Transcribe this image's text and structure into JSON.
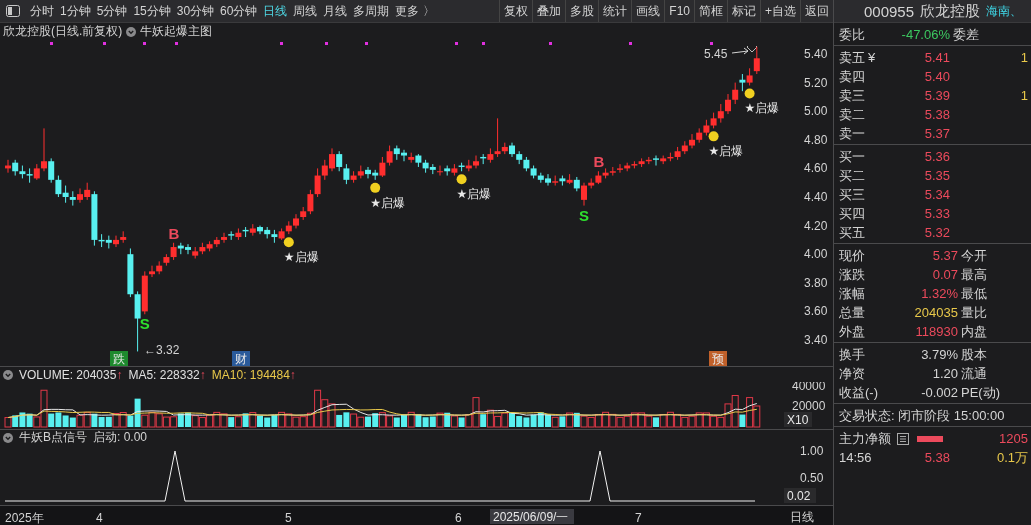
{
  "toolbar": {
    "periods": [
      {
        "label": "分时",
        "selected": false
      },
      {
        "label": "1分钟",
        "selected": false
      },
      {
        "label": "5分钟",
        "selected": false
      },
      {
        "label": "15分钟",
        "selected": false
      },
      {
        "label": "30分钟",
        "selected": false
      },
      {
        "label": "60分钟",
        "selected": false
      },
      {
        "label": "日线",
        "selected": true
      },
      {
        "label": "周线",
        "selected": false
      },
      {
        "label": "月线",
        "selected": false
      },
      {
        "label": "多周期",
        "selected": false
      },
      {
        "label": "更多 〉",
        "selected": false
      }
    ],
    "buttons": [
      "复权",
      "叠加",
      "多股",
      "统计",
      "画线",
      "F10",
      "简框",
      "标记",
      "+自选",
      "返回"
    ]
  },
  "chart_title": {
    "name": "欣龙控股(日线.前复权)",
    "indicator": "牛妖起爆主图"
  },
  "main_chart": {
    "chart_data": {
      "type": "candlestick",
      "ohlc": [
        [
          4.6,
          4.66,
          4.57,
          4.62
        ],
        [
          4.64,
          4.66,
          4.55,
          4.58
        ],
        [
          4.58,
          4.62,
          4.53,
          4.56
        ],
        [
          4.56,
          4.6,
          4.5,
          4.55
        ],
        [
          4.53,
          4.63,
          4.52,
          4.6
        ],
        [
          4.6,
          4.88,
          4.58,
          4.65
        ],
        [
          4.65,
          4.67,
          4.5,
          4.52
        ],
        [
          4.52,
          4.55,
          4.4,
          4.42
        ],
        [
          4.43,
          4.48,
          4.36,
          4.4
        ],
        [
          4.4,
          4.44,
          4.34,
          4.38
        ],
        [
          4.38,
          4.46,
          4.36,
          4.42
        ],
        [
          4.4,
          4.5,
          4.38,
          4.45
        ],
        [
          4.42,
          4.44,
          4.06,
          4.1
        ],
        [
          4.1,
          4.14,
          4.05,
          4.09
        ],
        [
          4.1,
          4.13,
          4.04,
          4.08
        ],
        [
          4.07,
          4.13,
          4.05,
          4.1
        ],
        [
          4.1,
          4.16,
          4.08,
          4.12
        ],
        [
          4.0,
          4.04,
          3.7,
          3.72
        ],
        [
          3.72,
          3.74,
          3.32,
          3.55
        ],
        [
          3.6,
          3.88,
          3.58,
          3.85
        ],
        [
          3.86,
          3.92,
          3.84,
          3.88
        ],
        [
          3.88,
          3.95,
          3.86,
          3.92
        ],
        [
          3.94,
          4.0,
          3.92,
          3.98
        ],
        [
          3.98,
          4.08,
          3.96,
          4.05
        ],
        [
          4.06,
          4.08,
          4.0,
          4.04
        ],
        [
          4.05,
          4.07,
          4.0,
          4.03
        ],
        [
          3.99,
          4.05,
          3.97,
          4.02
        ],
        [
          4.02,
          4.08,
          4.0,
          4.05
        ],
        [
          4.04,
          4.09,
          4.02,
          4.07
        ],
        [
          4.07,
          4.12,
          4.05,
          4.1
        ],
        [
          4.1,
          4.15,
          4.08,
          4.12
        ],
        [
          4.14,
          4.16,
          4.1,
          4.13
        ],
        [
          4.12,
          4.18,
          4.1,
          4.15
        ],
        [
          4.17,
          4.19,
          4.12,
          4.16
        ],
        [
          4.15,
          4.21,
          4.13,
          4.18
        ],
        [
          4.19,
          4.2,
          4.14,
          4.16
        ],
        [
          4.17,
          4.19,
          4.11,
          4.14
        ],
        [
          4.14,
          4.17,
          4.08,
          4.12
        ],
        [
          4.11,
          4.18,
          4.1,
          4.16
        ],
        [
          4.16,
          4.23,
          4.14,
          4.2
        ],
        [
          4.2,
          4.28,
          4.18,
          4.25
        ],
        [
          4.26,
          4.33,
          4.24,
          4.3
        ],
        [
          4.3,
          4.45,
          4.28,
          4.42
        ],
        [
          4.42,
          4.6,
          4.4,
          4.55
        ],
        [
          4.55,
          4.66,
          4.52,
          4.62
        ],
        [
          4.6,
          4.74,
          4.58,
          4.7
        ],
        [
          4.7,
          4.72,
          4.58,
          4.61
        ],
        [
          4.6,
          4.63,
          4.49,
          4.52
        ],
        [
          4.52,
          4.58,
          4.5,
          4.55
        ],
        [
          4.55,
          4.62,
          4.53,
          4.58
        ],
        [
          4.59,
          4.61,
          4.53,
          4.56
        ],
        [
          4.57,
          4.59,
          4.52,
          4.55
        ],
        [
          4.55,
          4.68,
          4.54,
          4.64
        ],
        [
          4.64,
          4.76,
          4.62,
          4.72
        ],
        [
          4.74,
          4.76,
          4.66,
          4.7
        ],
        [
          4.71,
          4.73,
          4.65,
          4.69
        ],
        [
          4.66,
          4.71,
          4.64,
          4.68
        ],
        [
          4.69,
          4.7,
          4.61,
          4.64
        ],
        [
          4.64,
          4.66,
          4.57,
          4.6
        ],
        [
          4.61,
          4.63,
          4.56,
          4.59
        ],
        [
          4.58,
          4.62,
          4.55,
          4.58
        ],
        [
          4.6,
          4.62,
          4.55,
          4.58
        ],
        [
          4.57,
          4.63,
          4.55,
          4.6
        ],
        [
          4.62,
          4.64,
          4.58,
          4.61
        ],
        [
          4.6,
          4.66,
          4.58,
          4.62
        ],
        [
          4.62,
          4.69,
          4.6,
          4.65
        ],
        [
          4.68,
          4.7,
          4.63,
          4.67
        ],
        [
          4.66,
          4.74,
          4.64,
          4.7
        ],
        [
          4.7,
          4.95,
          4.68,
          4.72
        ],
        [
          4.72,
          4.78,
          4.7,
          4.75
        ],
        [
          4.76,
          4.78,
          4.68,
          4.7
        ],
        [
          4.7,
          4.72,
          4.63,
          4.66
        ],
        [
          4.66,
          4.68,
          4.58,
          4.6
        ],
        [
          4.6,
          4.62,
          4.53,
          4.55
        ],
        [
          4.55,
          4.57,
          4.5,
          4.52
        ],
        [
          4.53,
          4.56,
          4.48,
          4.5
        ],
        [
          4.5,
          4.55,
          4.48,
          4.51
        ],
        [
          4.53,
          4.55,
          4.48,
          4.51
        ],
        [
          4.5,
          4.56,
          4.49,
          4.52
        ],
        [
          4.52,
          4.54,
          4.44,
          4.46
        ],
        [
          4.38,
          4.5,
          4.34,
          4.48
        ],
        [
          4.48,
          4.53,
          4.46,
          4.5
        ],
        [
          4.5,
          4.58,
          4.49,
          4.55
        ],
        [
          4.55,
          4.6,
          4.53,
          4.57
        ],
        [
          4.57,
          4.61,
          4.55,
          4.58
        ],
        [
          4.59,
          4.63,
          4.57,
          4.6
        ],
        [
          4.6,
          4.64,
          4.58,
          4.62
        ],
        [
          4.62,
          4.65,
          4.6,
          4.63
        ],
        [
          4.63,
          4.67,
          4.61,
          4.65
        ],
        [
          4.65,
          4.68,
          4.63,
          4.66
        ],
        [
          4.67,
          4.69,
          4.62,
          4.66
        ],
        [
          4.65,
          4.69,
          4.63,
          4.67
        ],
        [
          4.67,
          4.71,
          4.65,
          4.68
        ],
        [
          4.68,
          4.75,
          4.66,
          4.72
        ],
        [
          4.72,
          4.79,
          4.7,
          4.76
        ],
        [
          4.76,
          4.84,
          4.74,
          4.8
        ],
        [
          4.8,
          4.88,
          4.78,
          4.85
        ],
        [
          4.85,
          4.94,
          4.83,
          4.9
        ],
        [
          4.9,
          4.99,
          4.88,
          4.95
        ],
        [
          4.95,
          5.05,
          4.92,
          5.0
        ],
        [
          5.0,
          5.12,
          4.98,
          5.08
        ],
        [
          5.08,
          5.2,
          5.05,
          5.15
        ],
        [
          5.22,
          5.26,
          5.14,
          5.2
        ],
        [
          5.2,
          5.3,
          5.18,
          5.25
        ],
        [
          5.28,
          5.45,
          5.26,
          5.37
        ]
      ],
      "ylim": [
        3.4,
        5.4
      ],
      "yticks": [
        {
          "value": 5.4,
          "label": "5.40"
        },
        {
          "value": 5.2,
          "label": "5.20"
        },
        {
          "value": 5.0,
          "label": "5.00"
        },
        {
          "value": 4.8,
          "label": "4.80"
        },
        {
          "value": 4.6,
          "label": "4.60"
        },
        {
          "value": 4.4,
          "label": "4.40"
        },
        {
          "value": 4.2,
          "label": "4.20"
        },
        {
          "value": 4.0,
          "label": "4.00"
        },
        {
          "value": 3.8,
          "label": "3.80"
        },
        {
          "value": 3.6,
          "label": "3.60"
        },
        {
          "value": 3.4,
          "label": "3.40"
        }
      ]
    }
  },
  "annotations": {
    "high": "5.45",
    "low": "←3.32",
    "signals": [
      {
        "label": "★启爆"
      },
      {
        "label": "★启爆"
      },
      {
        "label": "★启爆"
      },
      {
        "label": "★启爆"
      },
      {
        "label": "★启爆"
      }
    ],
    "trades": [
      {
        "kind": "sell",
        "label": "S"
      },
      {
        "kind": "buy",
        "label": "B"
      },
      {
        "kind": "sell",
        "label": "S"
      },
      {
        "kind": "buy",
        "label": "B"
      }
    ],
    "events": [
      {
        "label": "跌",
        "color": "#1e8a2e"
      },
      {
        "label": "财",
        "color": "#2a5a9a"
      },
      {
        "label": "预",
        "color": "#c0602a"
      }
    ]
  },
  "volume": {
    "legend": [
      {
        "text": "VOLUME: 204035",
        "arrow": "↑",
        "color": "#e0e0e0"
      },
      {
        "text": "MA5: 228332",
        "arrow": "↑",
        "color": "#e0e0e0"
      },
      {
        "text": "MA10: 194484",
        "arrow": "↑",
        "color": "#e8c84a"
      }
    ],
    "axis": [
      "40000",
      "20000"
    ],
    "scale": "X10"
  },
  "signal": {
    "title": "牛妖B点信号",
    "value": "启动: 0.00",
    "axis": [
      "1.00",
      "0.50"
    ],
    "current": "0.02"
  },
  "date_axis": {
    "labels": [
      "2025年",
      "4",
      "5",
      "6",
      "7"
    ],
    "cursor": "2025/06/09/一",
    "period": "日线"
  },
  "quote": {
    "code": "000955",
    "name": "欣龙控股",
    "tag": "海南、",
    "ratio": {
      "label": "委比",
      "value": "-47.06%",
      "label2": "委差"
    },
    "asks": [
      {
        "label": "卖五",
        "mark": "¥",
        "price": "5.41",
        "volume": "1"
      },
      {
        "label": "卖四",
        "price": "5.40"
      },
      {
        "label": "卖三",
        "price": "5.39",
        "volume": "1"
      },
      {
        "label": "卖二",
        "price": "5.38"
      },
      {
        "label": "卖一",
        "price": "5.37"
      }
    ],
    "bids": [
      {
        "label": "买一",
        "price": "5.36"
      },
      {
        "label": "买二",
        "price": "5.35"
      },
      {
        "label": "买三",
        "price": "5.34"
      },
      {
        "label": "买四",
        "price": "5.33"
      },
      {
        "label": "买五",
        "price": "5.32"
      }
    ],
    "stats": [
      {
        "label": "现价",
        "value": "5.37",
        "label2": "今开",
        "color": "#ec4a5c"
      },
      {
        "label": "涨跌",
        "value": "0.07",
        "label2": "最高",
        "color": "#ec4a5c"
      },
      {
        "label": "涨幅",
        "value": "1.32%",
        "label2": "最低",
        "color": "#ec4a5c"
      },
      {
        "label": "总量",
        "value": "204035",
        "label2": "量比",
        "color": "#e8c84a"
      },
      {
        "label": "外盘",
        "value": "118930",
        "label2": "内盘",
        "color": "#ec4a5c"
      }
    ],
    "fundamentals": [
      {
        "label": "换手",
        "value": "3.79%",
        "label2": "股本"
      },
      {
        "label": "净资",
        "value": "1.20",
        "label2": "流通"
      },
      {
        "label": "收益(-)",
        "value": "-0.002",
        "label2": "PE(动)"
      }
    ],
    "status": "交易状态: 闭市阶段 15:00:00",
    "flow": {
      "label": "主力净额",
      "value": "1205"
    },
    "ticks": [
      {
        "time": "14:56",
        "price": "5.38",
        "volume": "0.1万"
      }
    ]
  }
}
